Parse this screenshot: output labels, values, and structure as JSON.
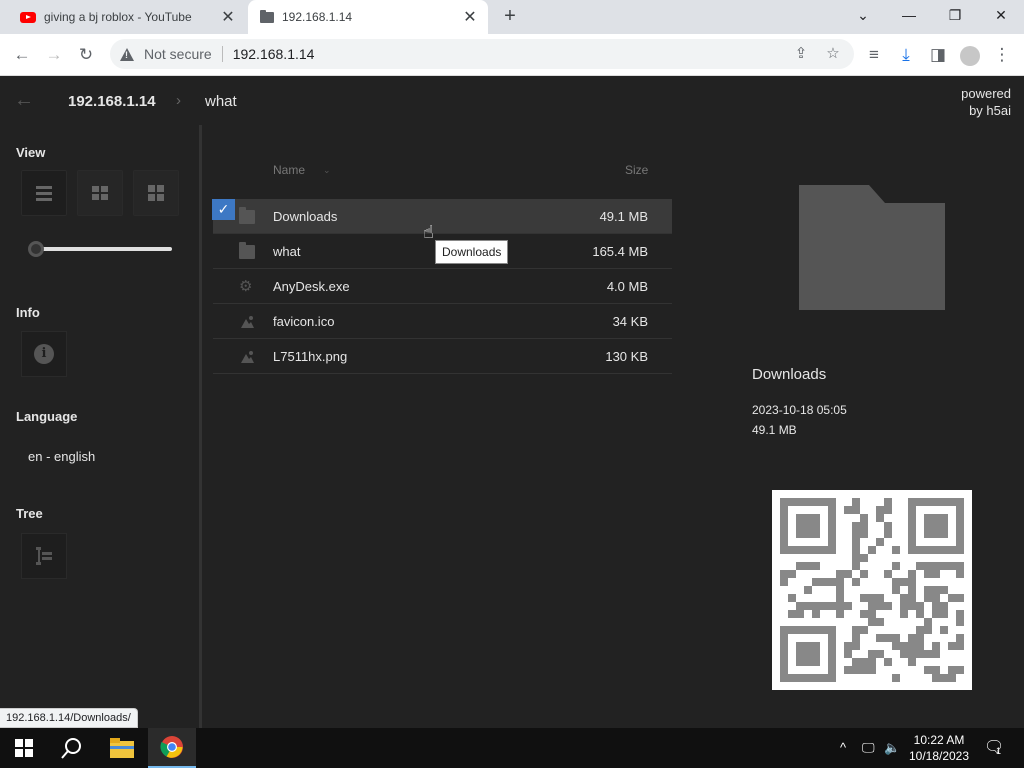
{
  "browser": {
    "tabs": [
      {
        "title": "giving a bj roblox - YouTube",
        "icon": "youtube-icon"
      },
      {
        "title": "192.168.1.14",
        "icon": "folder-icon"
      }
    ],
    "address": {
      "security_text": "Not secure",
      "url": "192.168.1.14"
    }
  },
  "page": {
    "breadcrumb": {
      "host": "192.168.1.14",
      "dir": "what"
    },
    "powered": {
      "line1": "powered",
      "line2": "by h5ai"
    }
  },
  "sidebar": {
    "view_label": "View",
    "info_label": "Info",
    "language_label": "Language",
    "language_value": "en - english",
    "tree_label": "Tree",
    "zoom_level": 0.0
  },
  "listing": {
    "headers": {
      "name": "Name",
      "size": "Size"
    },
    "rows": [
      {
        "name": "Downloads",
        "size": "49.1 MB",
        "type": "folder",
        "selected": true
      },
      {
        "name": "what",
        "size": "165.4 MB",
        "type": "folder",
        "selected": false
      },
      {
        "name": "AnyDesk.exe",
        "size": "4.0 MB",
        "type": "executable",
        "selected": false
      },
      {
        "name": "favicon.ico",
        "size": "34 KB",
        "type": "image",
        "selected": false
      },
      {
        "name": "L7511hx.png",
        "size": "130 KB",
        "type": "image",
        "selected": false
      }
    ],
    "tooltip": "Downloads"
  },
  "preview": {
    "name": "Downloads",
    "date": "2023-10-18 05:05",
    "size": "49.1 MB"
  },
  "status_url": "192.168.1.14/Downloads/",
  "taskbar": {
    "time": "10:22 AM",
    "date": "10/18/2023",
    "notification_count": "1"
  },
  "colors": {
    "accent": "#3d78c4",
    "page_bg": "#222222"
  }
}
